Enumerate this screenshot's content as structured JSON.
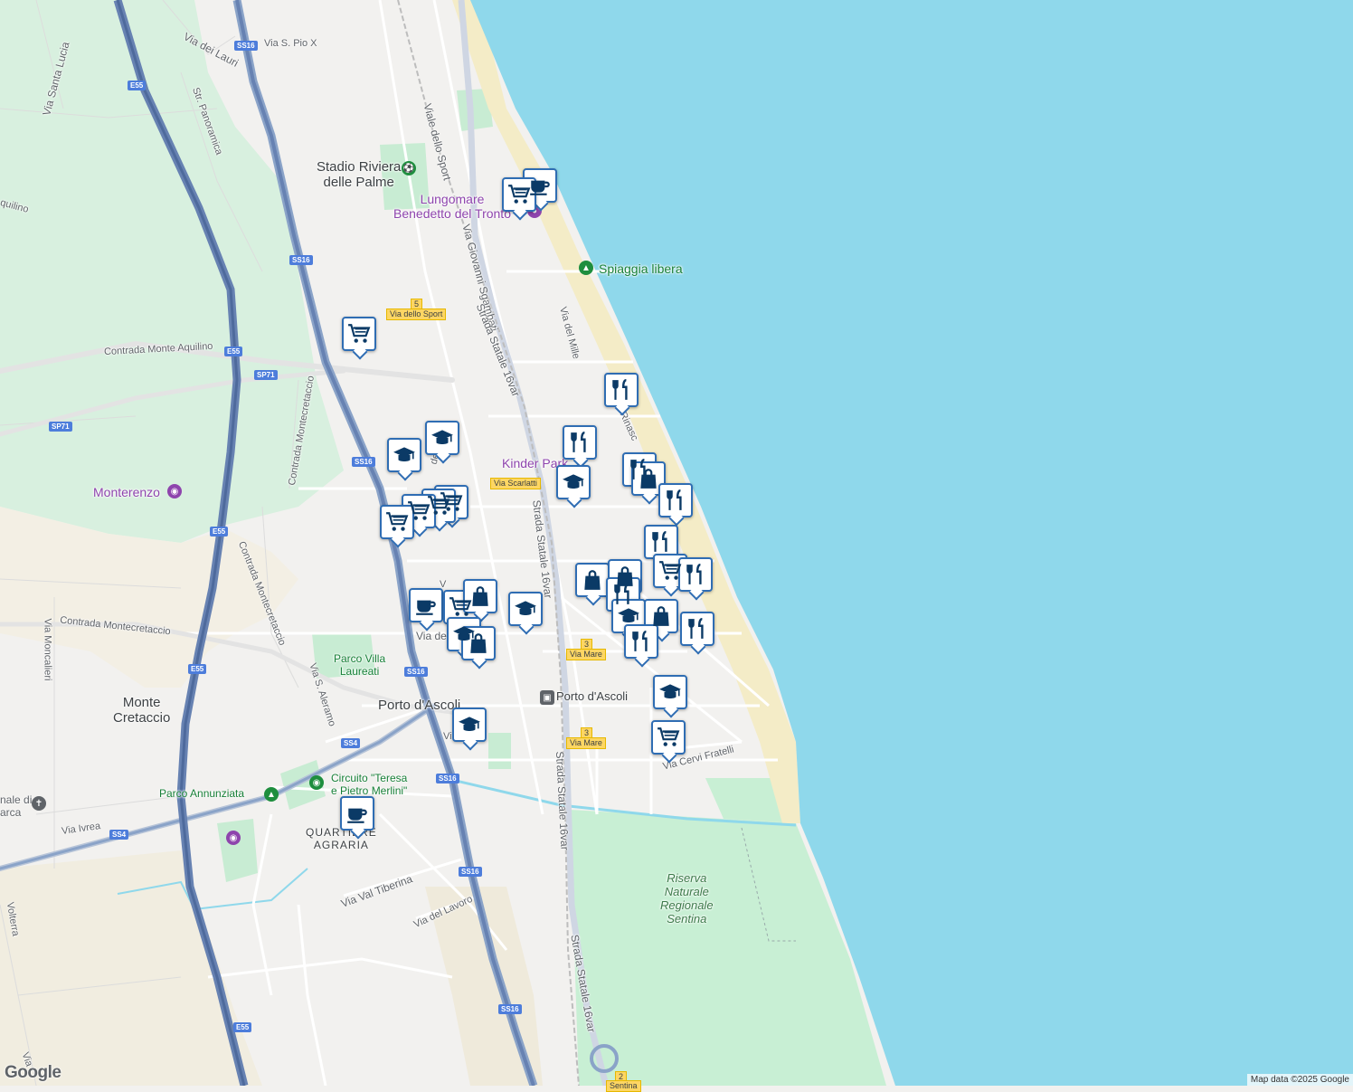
{
  "map": {
    "attribution": "Map data ©2025 Google",
    "logo": "Google",
    "colors": {
      "sea": "#8fd8eb",
      "land": "#f2f1ef",
      "park": "#c8ecd3",
      "motorway": "#6782b2",
      "marker_border": "#2f6db3"
    }
  },
  "places": {
    "stadio": "Stadio Riviera\ndelle Palme",
    "lungomare": "Lungomare\nBenedetto del Tronto",
    "spiaggia": "Spiaggia libera",
    "kinder_park": "Kinder Park",
    "monterenzo": "Monterenzo",
    "monte_cretaccio": "Monte\nCretaccio",
    "parco_villa": "Parco Villa\nLaureati",
    "porto_ascoli_town": "Porto d'Ascoli",
    "porto_ascoli_station": "Porto d'Ascoli",
    "circuito": "Circuito \"Teresa\ne Pietro Merlini\"",
    "parco_annunziata": "Parco Annunziata",
    "quartiere": "QUARTIERE\nAGRARIA",
    "riserva": "Riserva\nNaturale\nRegionale\nSentina",
    "santuario_fragment": "nale di\narca"
  },
  "streets": {
    "via_dei_lauri": "Via dei Lauri",
    "via_s_pio": "Via S. Pio X",
    "via_santa_lucia": "Via Santa Lucia",
    "str_panoramica": "Str. Panoramica",
    "viale_dello_sport": "Viale dello Sport",
    "via_giovanni": "Via Giovanni Sgambati",
    "strada_16var_a": "Strada Statale 16var",
    "strada_16var_b": "Strada Statale 16var",
    "strada_16var_c": "Strada Statale 16var",
    "strada_16var_d": "Strada Statale 16var",
    "via_del_mille": "Via del Mille",
    "rinascimento": "le Rinasc",
    "contrada_aquilino": "Contrada Monte Aquilino",
    "aquilino_left": "quilino",
    "contrada_monte_1": "Contrada Montecretaccio",
    "contrada_monte_2": "Contrada Montecretaccio",
    "contrada_monte_3": "Contrada Montecretaccio",
    "via_moncalieri": "Via Moncalieri",
    "via_s_aleramo": "Via S. Aleramo",
    "via_ivrea": "Via Ivrea",
    "via_val_tiberina": "Via Val Tiberina",
    "via_del_lavoro": "Via del Lavoro",
    "via_cervi": "Via Cervi Fratelli",
    "via_volterra": "Volterra",
    "via_left_bottom": "Via",
    "via_de": "Via de",
    "via_vi": "Vi",
    "via_v": "V",
    "via_del_frag": "del"
  },
  "shields": {
    "ss16_a": "SS16",
    "ss16_b": "SS16",
    "ss16_c": "SS16",
    "ss16_d": "SS16",
    "ss16_e": "SS16",
    "ss16_f": "SS16",
    "e55_a": "E55",
    "e55_b": "E55",
    "e55_c": "E55",
    "e55_d": "E55",
    "e55_e": "E55",
    "sp71_a": "SP71",
    "sp71_b": "SP71",
    "ss4_a": "SS4",
    "ss4_b": "SS4"
  },
  "exits": {
    "via_dello_sport_num": "5",
    "via_dello_sport": "Via dello Sport",
    "via_scarlatti": "Via Scarlatti",
    "via_mare_1_num": "3",
    "via_mare_1": "Via Mare",
    "via_mare_2_num": "3",
    "via_mare_2": "Via Mare",
    "sentina_num": "2",
    "sentina": "Sentina"
  },
  "markers": [
    {
      "icon": "cafe"
    },
    {
      "icon": "grocery"
    },
    {
      "icon": "grocery"
    },
    {
      "icon": "restaurant"
    },
    {
      "icon": "restaurant"
    },
    {
      "icon": "school"
    },
    {
      "icon": "school"
    },
    {
      "icon": "school"
    },
    {
      "icon": "grocery"
    },
    {
      "icon": "grocery"
    },
    {
      "icon": "grocery"
    },
    {
      "icon": "grocery"
    },
    {
      "icon": "restaurant"
    },
    {
      "icon": "shopping"
    },
    {
      "icon": "restaurant"
    },
    {
      "icon": "restaurant"
    },
    {
      "icon": "shopping"
    },
    {
      "icon": "shopping"
    },
    {
      "icon": "grocery"
    },
    {
      "icon": "restaurant"
    },
    {
      "icon": "restaurant"
    },
    {
      "icon": "cafe"
    },
    {
      "icon": "grocery"
    },
    {
      "icon": "shopping"
    },
    {
      "icon": "school"
    },
    {
      "icon": "school"
    },
    {
      "icon": "shopping"
    },
    {
      "icon": "school"
    },
    {
      "icon": "shopping"
    },
    {
      "icon": "restaurant"
    },
    {
      "icon": "restaurant"
    },
    {
      "icon": "school"
    },
    {
      "icon": "grocery"
    },
    {
      "icon": "school"
    },
    {
      "icon": "cafe"
    }
  ]
}
